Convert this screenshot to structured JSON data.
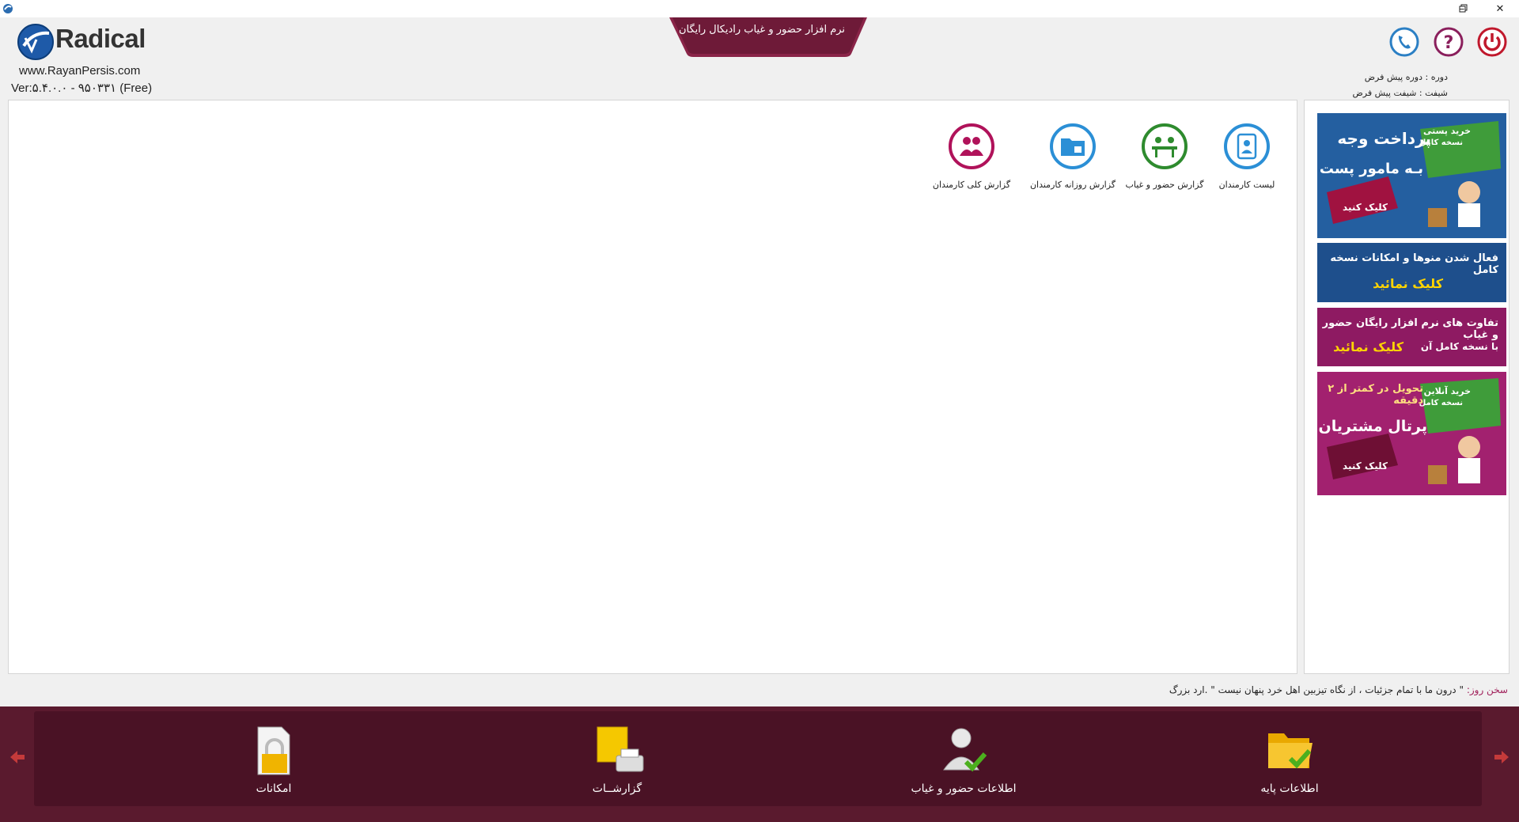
{
  "app": {
    "title": "نرم افزار حضور و غیاب رادیکال    رایگان",
    "brand": "Radical",
    "website": "www.RayanPersis.com",
    "version": "Ver:۵.۴.۰.۰ - ۹۵۰۳۳۱ (Free)"
  },
  "status": {
    "period": "دوره : دوره پیش فرض",
    "shift": "شیفت : شیفت پیش فرض"
  },
  "tiles": [
    {
      "label": "لیست کارمندان",
      "icon": "employee-list-icon",
      "color": "#2b8fd6"
    },
    {
      "label": "گزارش حضور و غیاب",
      "icon": "attendance-report-icon",
      "color": "#2e8b2e"
    },
    {
      "label": "گزارش روزانه کارمندان",
      "icon": "daily-report-icon",
      "color": "#2b8fd6"
    },
    {
      "label": "گزارش کلی کارمندان",
      "icon": "overall-report-icon",
      "color": "#b0125a"
    }
  ],
  "ads": [
    {
      "line1": "پرداخت وجه",
      "line2": "بـه مامور پست",
      "badge": "خرید پستی",
      "badge_sub": "نسخه کامل",
      "cta": "کلیک کنید"
    },
    {
      "line1": "فعال شدن منوها و امکانات نسخه کامل",
      "line2": "کلیک نمائید"
    },
    {
      "line1": "تفاوت های نرم افزار رایگان حضور و غیاب",
      "line2a": "با نسخه کامل آن",
      "line2b": "کلیک نمائید"
    },
    {
      "line1": "تحویل در کمتر از ۲ دقیقه",
      "line2": "پرتال مشتریان",
      "badge": "خرید آنلاین",
      "badge_sub": "نسخه کامل",
      "cta": "کلیک کنید"
    }
  ],
  "quote": {
    "label": "سخن روز:",
    "text": "\" درون ما با تمام جزئیات ، از نگاه تیزبین اهل خرد پنهان نیست \" .ارد بزرگ"
  },
  "bottom_menu": [
    {
      "label": "امکانات",
      "icon": "lock-document-icon"
    },
    {
      "label": "گزارشــات",
      "icon": "printer-report-icon"
    },
    {
      "label": "اطلاعات حضور و غیاب",
      "icon": "user-check-icon"
    },
    {
      "label": "اطلاعات پایه",
      "icon": "folder-check-icon"
    }
  ],
  "colors": {
    "brand_maroon": "#5a1a2e",
    "accent_blue": "#2b8fd6",
    "accent_green": "#2e8b2e",
    "accent_magenta": "#b0125a"
  }
}
